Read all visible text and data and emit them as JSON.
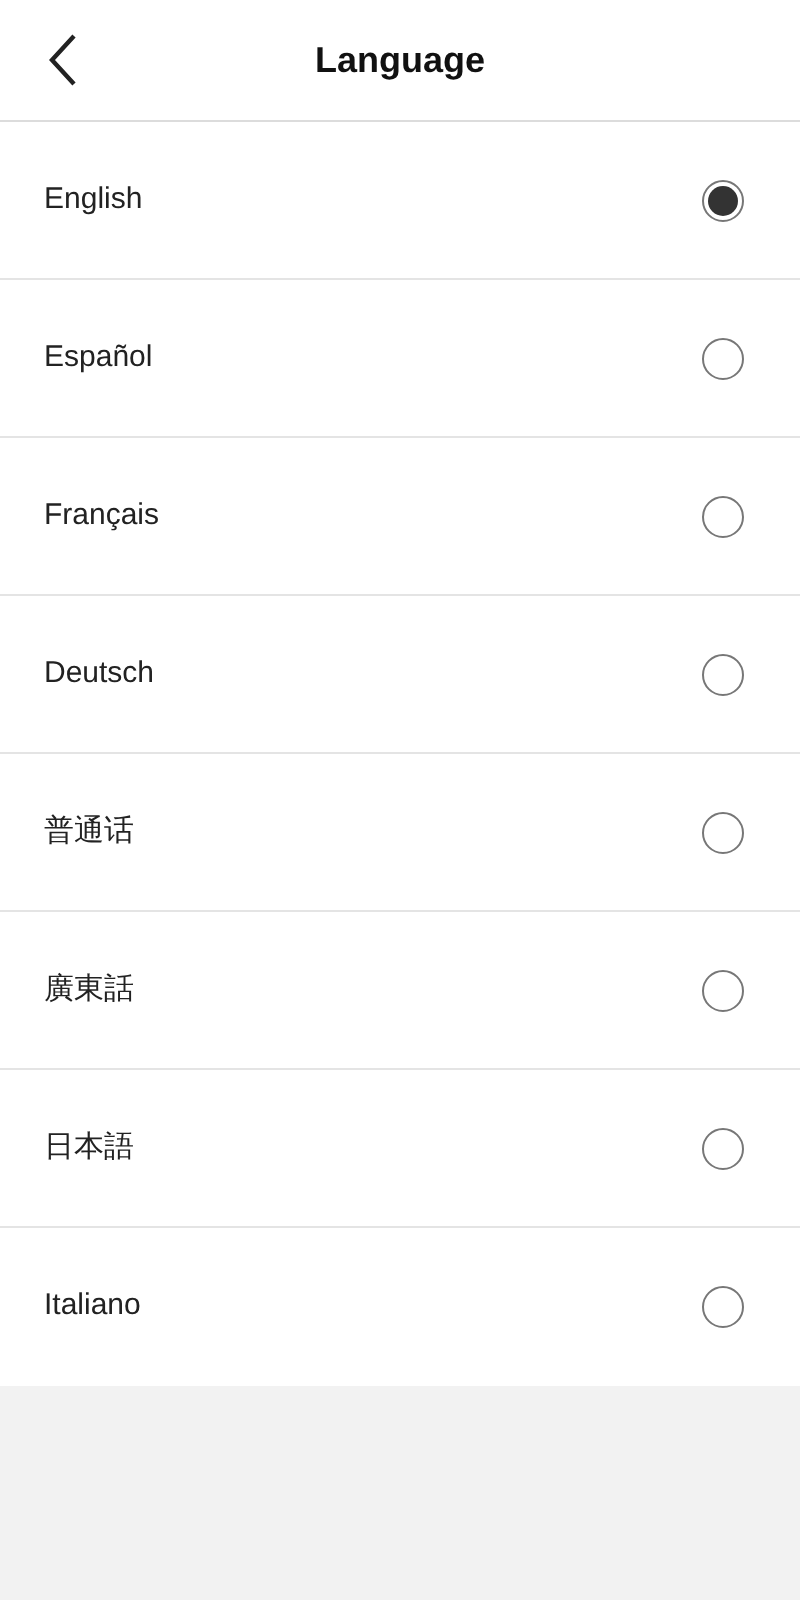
{
  "header": {
    "title": "Language"
  },
  "languages": [
    {
      "label": "English",
      "selected": true
    },
    {
      "label": "Español",
      "selected": false
    },
    {
      "label": "Français",
      "selected": false
    },
    {
      "label": "Deutsch",
      "selected": false
    },
    {
      "label": "普通话",
      "selected": false
    },
    {
      "label": "廣東話",
      "selected": false
    },
    {
      "label": "日本語",
      "selected": false
    },
    {
      "label": "Italiano",
      "selected": false
    }
  ]
}
